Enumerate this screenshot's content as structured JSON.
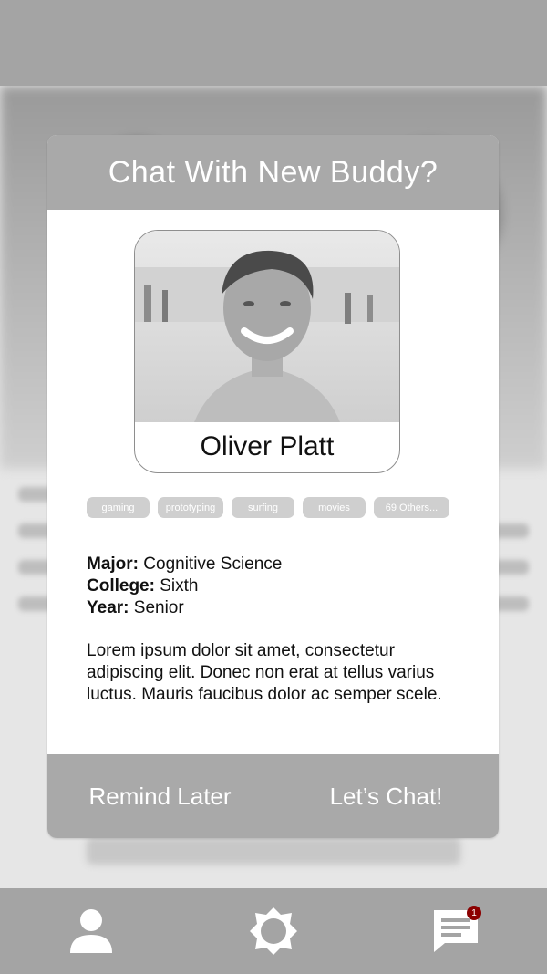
{
  "dialog": {
    "title": "Chat With New Buddy?",
    "profile": {
      "name": "Oliver Platt"
    },
    "tags": [
      "gaming",
      "prototyping",
      "surfing",
      "movies",
      "69 Others..."
    ],
    "info": {
      "major_label": "Major:",
      "major_value": "Cognitive Science",
      "college_label": "College:",
      "college_value": "Sixth",
      "year_label": "Year:",
      "year_value": "Senior"
    },
    "bio": "Lorem ipsum dolor sit amet, consectetur adipiscing elit. Donec non erat at tellus varius luctus. Mauris faucibus dolor ac semper scele.",
    "actions": {
      "remind_label": "Remind Later",
      "chat_label": "Let’s Chat!"
    }
  },
  "bottom_nav": {
    "items": [
      {
        "icon": "person-icon"
      },
      {
        "icon": "gear-icon"
      },
      {
        "icon": "chat-icon",
        "badge": "1"
      }
    ]
  },
  "colors": {
    "header": "#a9a9a9",
    "badge": "#8b0000",
    "tag_bg": "#cfcfcf"
  }
}
